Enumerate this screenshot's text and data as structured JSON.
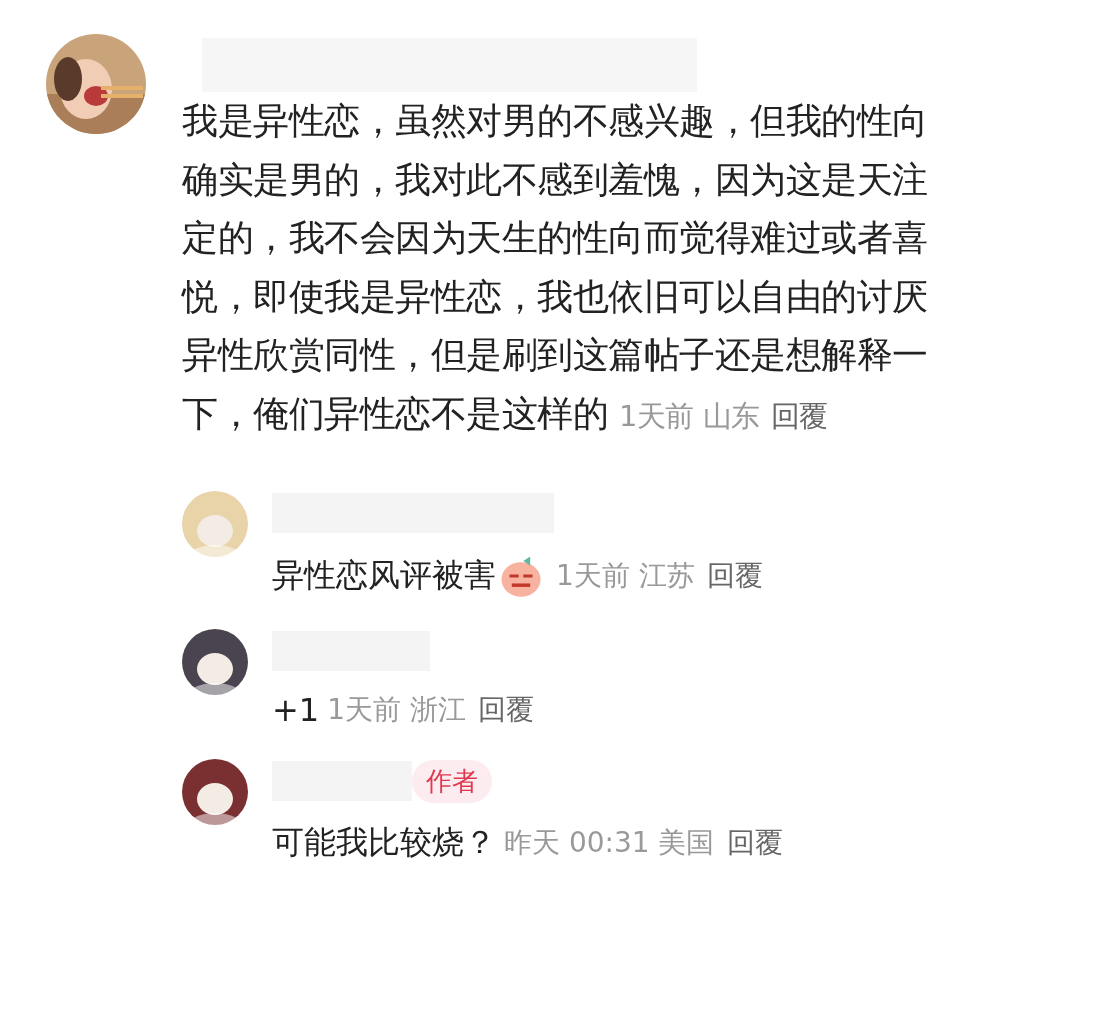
{
  "comment": {
    "body": "我是异性恋，虽然对男的不感兴趣，但我的性向确实是男的，我对此不感到羞愧，因为这是天注定的，我不会因为天生的性向而觉得难过或者喜悦，即使我是异性恋，我也依旧可以自由的讨厌异性欣赏同性，但是刷到这篇帖子还是想解释一下，俺们异性恋不是这样的",
    "time": "1天前",
    "location": "山东",
    "reply_label": "回覆",
    "replies": [
      {
        "body": "异性恋风评被害",
        "emoji": true,
        "author": false,
        "time": "1天前",
        "location": "江苏",
        "reply_label": "回覆"
      },
      {
        "body": "+1",
        "emoji": false,
        "author": false,
        "time": "1天前",
        "location": "浙江",
        "reply_label": "回覆"
      },
      {
        "body": "可能我比较烧？",
        "emoji": false,
        "author": true,
        "author_label": "作者",
        "time": "昨天 00:31",
        "location": "美国",
        "reply_label": "回覆"
      }
    ]
  }
}
